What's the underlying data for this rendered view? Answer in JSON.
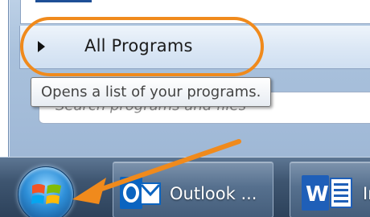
{
  "start_menu": {
    "all_programs_label": "All Programs",
    "search_placeholder": "Search programs and files"
  },
  "tooltip": {
    "text": "Opens a list of your programs."
  },
  "taskbar": {
    "items": [
      {
        "label": "Outlook ...",
        "icon": "outlook-icon"
      },
      {
        "label": "W≡  In",
        "icon": "word-icon"
      }
    ]
  },
  "annotation": {
    "highlight_color": "#f08a1c",
    "arrow_color": "#f08a1c"
  }
}
